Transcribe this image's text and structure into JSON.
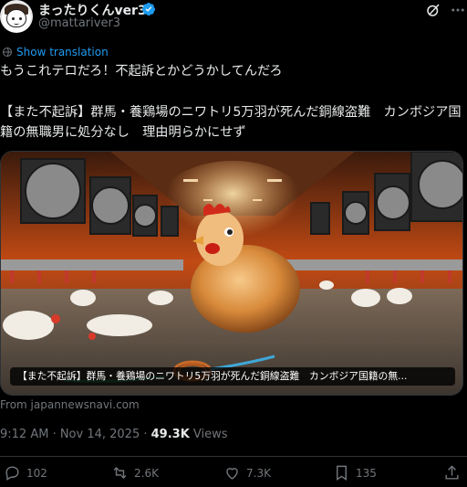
{
  "author": {
    "display_name": "まったりくんver3",
    "handle": "@mattariver3"
  },
  "icons": {
    "verified": "verified-badge-icon",
    "grok": "grok-icon",
    "more": "more-icon",
    "translate": "translate-icon",
    "reply": "reply-icon",
    "repost": "repost-icon",
    "like": "like-icon",
    "bookmark": "bookmark-icon",
    "share": "share-icon"
  },
  "colors": {
    "accent": "#1d9bf0",
    "muted": "#71767b",
    "text": "#e7e9ea",
    "background": "#000000"
  },
  "translate_label": "Show translation",
  "post": {
    "line1": "もうこれテロだろ！不起訴とかどうかしてんだろ",
    "line2": "【また不起訴】群馬・養鶏場のニワトリ5万羽が死んだ銅線盗難　カンボジア国籍の無職男に処分なし　理由明らかにせず"
  },
  "media": {
    "caption": "【また不起訴】群馬・養鶏場のニワトリ5万羽が死んだ銅線盗難　カンボジア国籍の無..."
  },
  "source_text": "From japannewsnavi.com",
  "meta": {
    "time": "9:12 AM · Nov 14, 2025 · ",
    "views_count": "49.3K",
    "views_label": " Views"
  },
  "actions": {
    "replies": "102",
    "reposts": "2.6K",
    "likes": "7.3K",
    "bookmarks": "135"
  }
}
